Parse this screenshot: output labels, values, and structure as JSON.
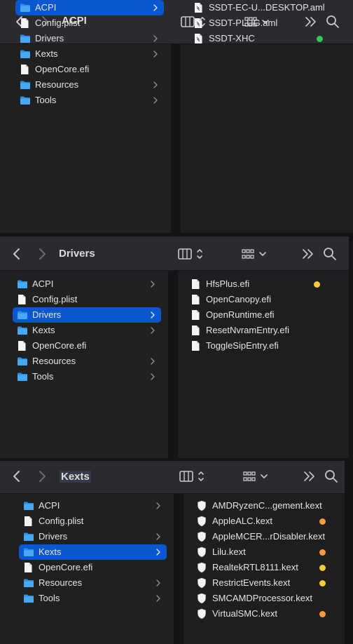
{
  "colors": {
    "selection": "#0b57d0",
    "tag_green": "#34c759",
    "tag_yellow": "#f5cc3b",
    "tag_orange": "#f6993f"
  },
  "windows": [
    {
      "title": "ACPI",
      "sidebar": [
        {
          "label": "ACPI",
          "icon": "folder-icon",
          "chevron": true,
          "selected": true
        },
        {
          "label": "Config.plist",
          "icon": "document-icon",
          "chevron": false
        },
        {
          "label": "Drivers",
          "icon": "folder-icon",
          "chevron": true
        },
        {
          "label": "Kexts",
          "icon": "folder-icon",
          "chevron": true
        },
        {
          "label": "OpenCore.efi",
          "icon": "document-icon",
          "chevron": false
        },
        {
          "label": "Resources",
          "icon": "folder-icon",
          "chevron": true
        },
        {
          "label": "Tools",
          "icon": "folder-icon",
          "chevron": true
        }
      ],
      "files": [
        {
          "label": "SSDT-EC-U...DESKTOP.aml",
          "icon": "aml-file-icon"
        },
        {
          "label": "SSDT-PLUG.aml",
          "icon": "aml-file-icon"
        },
        {
          "label": "SSDT-XHC",
          "icon": "aml-file-icon",
          "tag": "green"
        }
      ]
    },
    {
      "title": "Drivers",
      "sidebar": [
        {
          "label": "ACPI",
          "icon": "folder-icon",
          "chevron": true
        },
        {
          "label": "Config.plist",
          "icon": "document-icon",
          "chevron": false
        },
        {
          "label": "Drivers",
          "icon": "folder-icon",
          "chevron": true,
          "selected": true
        },
        {
          "label": "Kexts",
          "icon": "folder-icon",
          "chevron": true
        },
        {
          "label": "OpenCore.efi",
          "icon": "document-icon",
          "chevron": false
        },
        {
          "label": "Resources",
          "icon": "folder-icon",
          "chevron": true
        },
        {
          "label": "Tools",
          "icon": "folder-icon",
          "chevron": true
        }
      ],
      "files": [
        {
          "label": "HfsPlus.efi",
          "icon": "document-icon",
          "tag": "yellow"
        },
        {
          "label": "OpenCanopy.efi",
          "icon": "document-icon"
        },
        {
          "label": "OpenRuntime.efi",
          "icon": "document-icon"
        },
        {
          "label": "ResetNvramEntry.efi",
          "icon": "document-icon"
        },
        {
          "label": "ToggleSipEntry.efi",
          "icon": "document-icon"
        }
      ]
    },
    {
      "title": "Kexts",
      "sidebar": [
        {
          "label": "ACPI",
          "icon": "folder-icon",
          "chevron": true
        },
        {
          "label": "Config.plist",
          "icon": "document-icon",
          "chevron": false
        },
        {
          "label": "Drivers",
          "icon": "folder-icon",
          "chevron": true
        },
        {
          "label": "Kexts",
          "icon": "folder-icon",
          "chevron": true,
          "selected": true
        },
        {
          "label": "OpenCore.efi",
          "icon": "document-icon",
          "chevron": false
        },
        {
          "label": "Resources",
          "icon": "folder-icon",
          "chevron": true
        },
        {
          "label": "Tools",
          "icon": "folder-icon",
          "chevron": true
        }
      ],
      "files": [
        {
          "label": "AMDRyzenC...gement.kext",
          "icon": "kext-icon"
        },
        {
          "label": "AppleALC.kext",
          "icon": "kext-icon",
          "tag": "orange"
        },
        {
          "label": "AppleMCER...rDisabler.kext",
          "icon": "kext-icon"
        },
        {
          "label": "Lilu.kext",
          "icon": "kext-icon",
          "tag": "orange"
        },
        {
          "label": "RealtekRTL8111.kext",
          "icon": "kext-icon",
          "tag": "yellow"
        },
        {
          "label": "RestrictEvents.kext",
          "icon": "kext-icon",
          "tag": "yellow"
        },
        {
          "label": "SMCAMDProcessor.kext",
          "icon": "kext-icon"
        },
        {
          "label": "VirtualSMC.kext",
          "icon": "kext-icon",
          "tag": "orange"
        }
      ]
    }
  ]
}
